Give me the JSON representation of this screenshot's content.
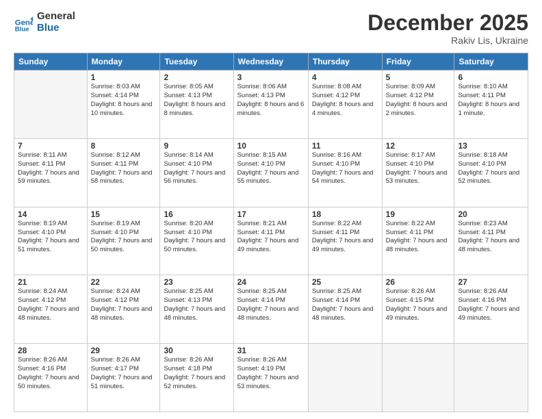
{
  "header": {
    "logo_line1": "General",
    "logo_line2": "Blue",
    "month": "December 2025",
    "location": "Rakiv Lis, Ukraine"
  },
  "weekdays": [
    "Sunday",
    "Monday",
    "Tuesday",
    "Wednesday",
    "Thursday",
    "Friday",
    "Saturday"
  ],
  "weeks": [
    [
      {
        "day": "",
        "sunrise": "",
        "sunset": "",
        "daylight": ""
      },
      {
        "day": "1",
        "sunrise": "Sunrise: 8:03 AM",
        "sunset": "Sunset: 4:14 PM",
        "daylight": "Daylight: 8 hours and 10 minutes."
      },
      {
        "day": "2",
        "sunrise": "Sunrise: 8:05 AM",
        "sunset": "Sunset: 4:13 PM",
        "daylight": "Daylight: 8 hours and 8 minutes."
      },
      {
        "day": "3",
        "sunrise": "Sunrise: 8:06 AM",
        "sunset": "Sunset: 4:13 PM",
        "daylight": "Daylight: 8 hours and 6 minutes."
      },
      {
        "day": "4",
        "sunrise": "Sunrise: 8:08 AM",
        "sunset": "Sunset: 4:12 PM",
        "daylight": "Daylight: 8 hours and 4 minutes."
      },
      {
        "day": "5",
        "sunrise": "Sunrise: 8:09 AM",
        "sunset": "Sunset: 4:12 PM",
        "daylight": "Daylight: 8 hours and 2 minutes."
      },
      {
        "day": "6",
        "sunrise": "Sunrise: 8:10 AM",
        "sunset": "Sunset: 4:11 PM",
        "daylight": "Daylight: 8 hours and 1 minute."
      }
    ],
    [
      {
        "day": "7",
        "sunrise": "Sunrise: 8:11 AM",
        "sunset": "Sunset: 4:11 PM",
        "daylight": "Daylight: 7 hours and 59 minutes."
      },
      {
        "day": "8",
        "sunrise": "Sunrise: 8:12 AM",
        "sunset": "Sunset: 4:11 PM",
        "daylight": "Daylight: 7 hours and 58 minutes."
      },
      {
        "day": "9",
        "sunrise": "Sunrise: 8:14 AM",
        "sunset": "Sunset: 4:10 PM",
        "daylight": "Daylight: 7 hours and 56 minutes."
      },
      {
        "day": "10",
        "sunrise": "Sunrise: 8:15 AM",
        "sunset": "Sunset: 4:10 PM",
        "daylight": "Daylight: 7 hours and 55 minutes."
      },
      {
        "day": "11",
        "sunrise": "Sunrise: 8:16 AM",
        "sunset": "Sunset: 4:10 PM",
        "daylight": "Daylight: 7 hours and 54 minutes."
      },
      {
        "day": "12",
        "sunrise": "Sunrise: 8:17 AM",
        "sunset": "Sunset: 4:10 PM",
        "daylight": "Daylight: 7 hours and 53 minutes."
      },
      {
        "day": "13",
        "sunrise": "Sunrise: 8:18 AM",
        "sunset": "Sunset: 4:10 PM",
        "daylight": "Daylight: 7 hours and 52 minutes."
      }
    ],
    [
      {
        "day": "14",
        "sunrise": "Sunrise: 8:19 AM",
        "sunset": "Sunset: 4:10 PM",
        "daylight": "Daylight: 7 hours and 51 minutes."
      },
      {
        "day": "15",
        "sunrise": "Sunrise: 8:19 AM",
        "sunset": "Sunset: 4:10 PM",
        "daylight": "Daylight: 7 hours and 50 minutes."
      },
      {
        "day": "16",
        "sunrise": "Sunrise: 8:20 AM",
        "sunset": "Sunset: 4:10 PM",
        "daylight": "Daylight: 7 hours and 50 minutes."
      },
      {
        "day": "17",
        "sunrise": "Sunrise: 8:21 AM",
        "sunset": "Sunset: 4:11 PM",
        "daylight": "Daylight: 7 hours and 49 minutes."
      },
      {
        "day": "18",
        "sunrise": "Sunrise: 8:22 AM",
        "sunset": "Sunset: 4:11 PM",
        "daylight": "Daylight: 7 hours and 49 minutes."
      },
      {
        "day": "19",
        "sunrise": "Sunrise: 8:22 AM",
        "sunset": "Sunset: 4:11 PM",
        "daylight": "Daylight: 7 hours and 48 minutes."
      },
      {
        "day": "20",
        "sunrise": "Sunrise: 8:23 AM",
        "sunset": "Sunset: 4:11 PM",
        "daylight": "Daylight: 7 hours and 48 minutes."
      }
    ],
    [
      {
        "day": "21",
        "sunrise": "Sunrise: 8:24 AM",
        "sunset": "Sunset: 4:12 PM",
        "daylight": "Daylight: 7 hours and 48 minutes."
      },
      {
        "day": "22",
        "sunrise": "Sunrise: 8:24 AM",
        "sunset": "Sunset: 4:12 PM",
        "daylight": "Daylight: 7 hours and 48 minutes."
      },
      {
        "day": "23",
        "sunrise": "Sunrise: 8:25 AM",
        "sunset": "Sunset: 4:13 PM",
        "daylight": "Daylight: 7 hours and 48 minutes."
      },
      {
        "day": "24",
        "sunrise": "Sunrise: 8:25 AM",
        "sunset": "Sunset: 4:14 PM",
        "daylight": "Daylight: 7 hours and 48 minutes."
      },
      {
        "day": "25",
        "sunrise": "Sunrise: 8:25 AM",
        "sunset": "Sunset: 4:14 PM",
        "daylight": "Daylight: 7 hours and 48 minutes."
      },
      {
        "day": "26",
        "sunrise": "Sunrise: 8:26 AM",
        "sunset": "Sunset: 4:15 PM",
        "daylight": "Daylight: 7 hours and 49 minutes."
      },
      {
        "day": "27",
        "sunrise": "Sunrise: 8:26 AM",
        "sunset": "Sunset: 4:16 PM",
        "daylight": "Daylight: 7 hours and 49 minutes."
      }
    ],
    [
      {
        "day": "28",
        "sunrise": "Sunrise: 8:26 AM",
        "sunset": "Sunset: 4:16 PM",
        "daylight": "Daylight: 7 hours and 50 minutes."
      },
      {
        "day": "29",
        "sunrise": "Sunrise: 8:26 AM",
        "sunset": "Sunset: 4:17 PM",
        "daylight": "Daylight: 7 hours and 51 minutes."
      },
      {
        "day": "30",
        "sunrise": "Sunrise: 8:26 AM",
        "sunset": "Sunset: 4:18 PM",
        "daylight": "Daylight: 7 hours and 52 minutes."
      },
      {
        "day": "31",
        "sunrise": "Sunrise: 8:26 AM",
        "sunset": "Sunset: 4:19 PM",
        "daylight": "Daylight: 7 hours and 53 minutes."
      },
      {
        "day": "",
        "sunrise": "",
        "sunset": "",
        "daylight": ""
      },
      {
        "day": "",
        "sunrise": "",
        "sunset": "",
        "daylight": ""
      },
      {
        "day": "",
        "sunrise": "",
        "sunset": "",
        "daylight": ""
      }
    ]
  ]
}
